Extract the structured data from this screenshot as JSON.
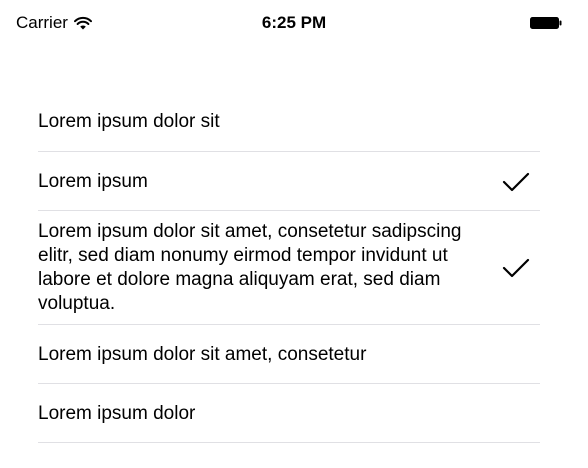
{
  "status_bar": {
    "carrier": "Carrier",
    "time": "6:25 PM",
    "wifi_icon": "wifi-icon",
    "battery_icon": "battery-full-icon"
  },
  "list": {
    "items": [
      {
        "label": "Lorem ipsum dolor sit",
        "checked": false
      },
      {
        "label": "Lorem ipsum",
        "checked": true
      },
      {
        "label": "Lorem ipsum dolor sit amet, consetetur sadipscing elitr, sed diam nonumy eirmod tempor invidunt ut labore et dolore magna aliquyam erat, sed diam voluptua.",
        "checked": true
      },
      {
        "label": "Lorem ipsum dolor sit amet, consetetur",
        "checked": false
      },
      {
        "label": "Lorem ipsum dolor",
        "checked": false
      }
    ],
    "check_icon": "checkmark-icon",
    "accent_color": "#000000",
    "separator_color": "#e0e0e4"
  }
}
